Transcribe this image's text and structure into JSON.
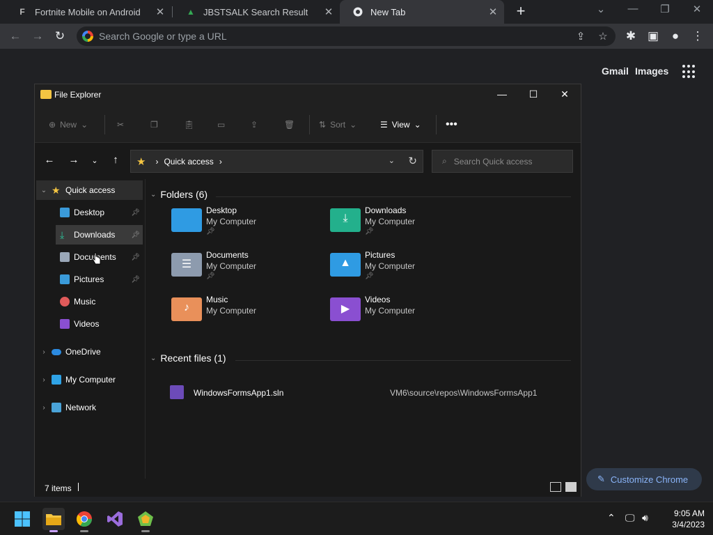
{
  "browser": {
    "tabs": [
      {
        "title": "Fortnite Mobile on Android",
        "favicon": "fortnite-icon"
      },
      {
        "title": "JBSTSALK Search Result",
        "favicon": "jbstsalk-icon"
      },
      {
        "title": "New Tab",
        "favicon": "chrome-icon",
        "active": true
      }
    ],
    "omnibox_placeholder": "Search Google or type a URL",
    "ntp": {
      "gmail": "Gmail",
      "images": "Images",
      "customize": "Customize Chrome"
    }
  },
  "explorer": {
    "title": "File Explorer",
    "commands": {
      "new": "New",
      "sort": "Sort",
      "view": "View"
    },
    "address": {
      "location": "Quick access"
    },
    "search_placeholder": "Search Quick access",
    "nav": {
      "quick_access": "Quick access",
      "items": [
        {
          "label": "Desktop",
          "pinned": true
        },
        {
          "label": "Downloads",
          "pinned": true
        },
        {
          "label": "Documents",
          "pinned": true
        },
        {
          "label": "Pictures",
          "pinned": true
        },
        {
          "label": "Music"
        },
        {
          "label": "Videos"
        }
      ],
      "roots": [
        "OneDrive",
        "My Computer",
        "Network"
      ]
    },
    "folders_header": "Folders (6)",
    "folders": [
      {
        "name": "Desktop",
        "location": "My Computer",
        "pinned": true
      },
      {
        "name": "Downloads",
        "location": "My Computer",
        "pinned": true
      },
      {
        "name": "Documents",
        "location": "My Computer",
        "pinned": true
      },
      {
        "name": "Pictures",
        "location": "My Computer",
        "pinned": true
      },
      {
        "name": "Music",
        "location": "My Computer"
      },
      {
        "name": "Videos",
        "location": "My Computer"
      }
    ],
    "recent_header": "Recent files (1)",
    "recent": [
      {
        "name": "WindowsFormsApp1.sln",
        "path": "VM6\\source\\repos\\WindowsFormsApp1"
      }
    ],
    "status": {
      "count": "7 items"
    }
  },
  "taskbar": {
    "clock": {
      "time": "9:05 AM",
      "date": "3/4/2023"
    }
  },
  "colors": {
    "accent": "#8ab4f8",
    "folder": "#f4c542",
    "explorer_bg": "#191919"
  }
}
